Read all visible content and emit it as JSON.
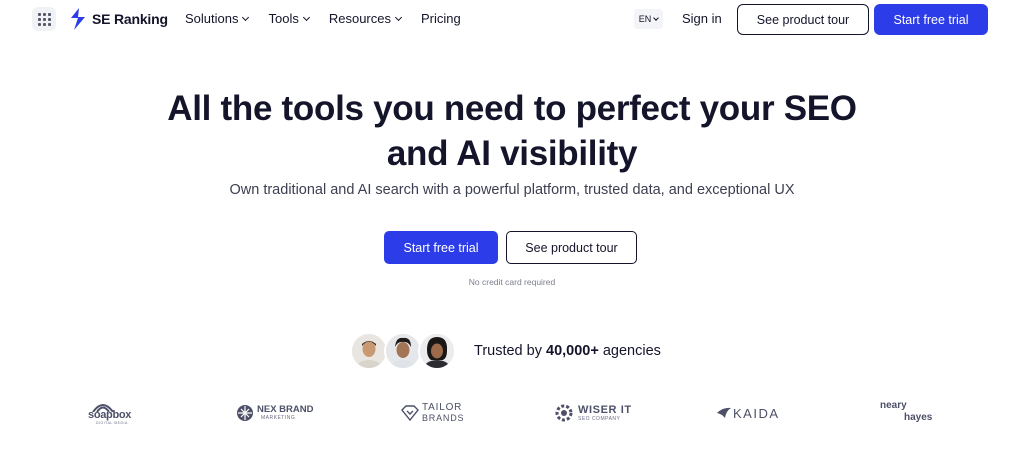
{
  "header": {
    "logo_text": "SE Ranking",
    "menu": [
      {
        "label": "Solutions",
        "has_dropdown": true
      },
      {
        "label": "Tools",
        "has_dropdown": true
      },
      {
        "label": "Resources",
        "has_dropdown": true
      },
      {
        "label": "Pricing",
        "has_dropdown": false
      }
    ],
    "language": "EN",
    "sign_in": "Sign in",
    "product_tour": "See product tour",
    "free_trial": "Start free trial"
  },
  "hero": {
    "title_line1": "All the tools you need to perfect your SEO",
    "title_line2": "and AI visibility",
    "subtitle": "Own traditional and AI search with a powerful platform, trusted data, and exceptional UX",
    "cta_primary": "Start free trial",
    "cta_secondary": "See product tour",
    "note": "No credit card required"
  },
  "trust": {
    "prefix": "Trusted by",
    "count": "40,000+",
    "suffix": "agencies"
  },
  "client_logos": [
    {
      "name": "soapbox",
      "sub": "DIGITAL MEDIA"
    },
    {
      "name": "NEX BRAND",
      "sub": "MARKETING"
    },
    {
      "name": "TAILOR",
      "sub": "BRANDS"
    },
    {
      "name": "WISER IT",
      "sub": "SEO COMPANY"
    },
    {
      "name": "KAIDA",
      "sub": ""
    },
    {
      "name": "neary",
      "sub": "hayes"
    }
  ],
  "colors": {
    "primary": "#2b3ce8",
    "text": "#14142b",
    "muted": "#7b7e8c"
  }
}
